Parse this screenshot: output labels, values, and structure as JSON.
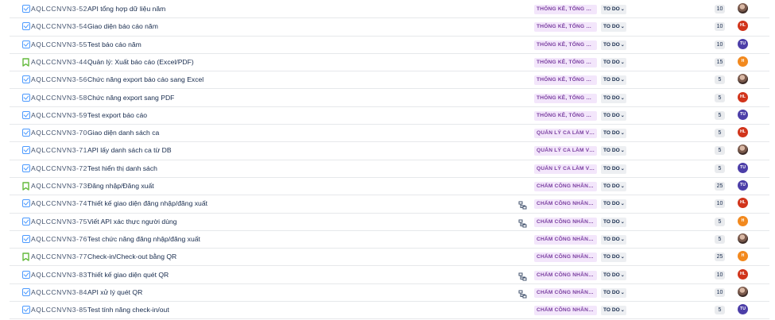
{
  "colors": {
    "avatar_HL": "#d1341b",
    "avatar_TU": "#4c3ea8",
    "avatar_H": "#f2891e",
    "label_bg": "#f3e6fb",
    "label_text": "#7a3fa0"
  },
  "issues": [
    {
      "type": "task",
      "key": "AQLCCNVN3-52",
      "summary": "API tổng hợp dữ liệu năm",
      "child_icon": false,
      "label": "THỐNG KÊ, TỔNG HỢ...",
      "status": "TO DO",
      "points": "10",
      "assignee": "photo",
      "assignee_initials": ""
    },
    {
      "type": "task",
      "key": "AQLCCNVN3-54",
      "summary": "Giao diện báo cáo năm",
      "child_icon": false,
      "label": "THỐNG KÊ, TỔNG HỢ...",
      "status": "TO DO",
      "points": "10",
      "assignee": "HL",
      "assignee_initials": "HL"
    },
    {
      "type": "task",
      "key": "AQLCCNVN3-55",
      "summary": "Test báo cáo năm",
      "child_icon": false,
      "label": "THỐNG KÊ, TỔNG HỢ...",
      "status": "TO DO",
      "points": "10",
      "assignee": "TU",
      "assignee_initials": "TU"
    },
    {
      "type": "story",
      "key": "AQLCCNVN3-44",
      "summary": "Quản lý: Xuất báo cáo (Excel/PDF)",
      "child_icon": false,
      "label": "THỐNG KÊ, TỔNG HỢ...",
      "status": "TO DO",
      "points": "15",
      "assignee": "H",
      "assignee_initials": "H"
    },
    {
      "type": "task",
      "key": "AQLCCNVN3-56",
      "summary": "Chức năng export báo cáo sang Excel",
      "child_icon": false,
      "label": "THỐNG KÊ, TỔNG HỢ...",
      "status": "TO DO",
      "points": "5",
      "assignee": "photo",
      "assignee_initials": ""
    },
    {
      "type": "task",
      "key": "AQLCCNVN3-58",
      "summary": "Chức năng export sang PDF",
      "child_icon": false,
      "label": "THỐNG KÊ, TỔNG HỢ...",
      "status": "TO DO",
      "points": "5",
      "assignee": "HL",
      "assignee_initials": "HL"
    },
    {
      "type": "task",
      "key": "AQLCCNVN3-59",
      "summary": "Test export báo cáo",
      "child_icon": false,
      "label": "THỐNG KÊ, TỔNG HỢ...",
      "status": "TO DO",
      "points": "5",
      "assignee": "TU",
      "assignee_initials": "TU"
    },
    {
      "type": "task",
      "key": "AQLCCNVN3-70",
      "summary": "Giao diện danh sách ca",
      "child_icon": false,
      "label": "QUẢN LÝ CA LÀM VIỆC",
      "status": "TO DO",
      "points": "5",
      "assignee": "HL",
      "assignee_initials": "HL"
    },
    {
      "type": "task",
      "key": "AQLCCNVN3-71",
      "summary": "API lấy danh sách ca từ DB",
      "child_icon": false,
      "label": "QUẢN LÝ CA LÀM VIỆC",
      "status": "TO DO",
      "points": "5",
      "assignee": "photo",
      "assignee_initials": ""
    },
    {
      "type": "task",
      "key": "AQLCCNVN3-72",
      "summary": "Test hiển thị danh sách",
      "child_icon": false,
      "label": "QUẢN LÝ CA LÀM VIỆC",
      "status": "TO DO",
      "points": "5",
      "assignee": "TU",
      "assignee_initials": "TU"
    },
    {
      "type": "story",
      "key": "AQLCCNVN3-73",
      "summary": "Đăng nhập/Đăng xuất",
      "child_icon": false,
      "label": "CHẤM CÔNG NHÂN V...",
      "status": "TO DO",
      "points": "25",
      "assignee": "TU",
      "assignee_initials": "TU"
    },
    {
      "type": "task",
      "key": "AQLCCNVN3-74",
      "summary": "Thiết kế giao diện đăng nhập/đăng xuất",
      "child_icon": true,
      "label": "CHẤM CÔNG NHÂN V...",
      "status": "TO DO",
      "points": "10",
      "assignee": "HL",
      "assignee_initials": "HL"
    },
    {
      "type": "task",
      "key": "AQLCCNVN3-75",
      "summary": "Viết API xác thực người dùng",
      "child_icon": true,
      "label": "CHẤM CÔNG NHÂN V...",
      "status": "TO DO",
      "points": "5",
      "assignee": "H",
      "assignee_initials": "H"
    },
    {
      "type": "task",
      "key": "AQLCCNVN3-76",
      "summary": "Test chức năng đăng nhập/đăng xuất",
      "child_icon": false,
      "label": "CHẤM CÔNG NHÂN V...",
      "status": "TO DO",
      "points": "5",
      "assignee": "photo",
      "assignee_initials": ""
    },
    {
      "type": "story",
      "key": "AQLCCNVN3-77",
      "summary": "Check-in/Check-out bằng QR",
      "child_icon": false,
      "label": "CHẤM CÔNG NHÂN V...",
      "status": "TO DO",
      "points": "25",
      "assignee": "H",
      "assignee_initials": "H"
    },
    {
      "type": "task",
      "key": "AQLCCNVN3-83",
      "summary": "Thiết kế giao diện quét QR",
      "child_icon": true,
      "label": "CHẤM CÔNG NHÂN V...",
      "status": "TO DO",
      "points": "10",
      "assignee": "HL",
      "assignee_initials": "HL"
    },
    {
      "type": "task",
      "key": "AQLCCNVN3-84",
      "summary": "API xử lý quét QR",
      "child_icon": true,
      "label": "CHẤM CÔNG NHÂN V...",
      "status": "TO DO",
      "points": "10",
      "assignee": "photo",
      "assignee_initials": ""
    },
    {
      "type": "task",
      "key": "AQLCCNVN3-85",
      "summary": "Test tính năng check-in/out",
      "child_icon": false,
      "label": "CHẤM CÔNG NHÂN V...",
      "status": "TO DO",
      "points": "5",
      "assignee": "TU",
      "assignee_initials": "TU"
    }
  ]
}
